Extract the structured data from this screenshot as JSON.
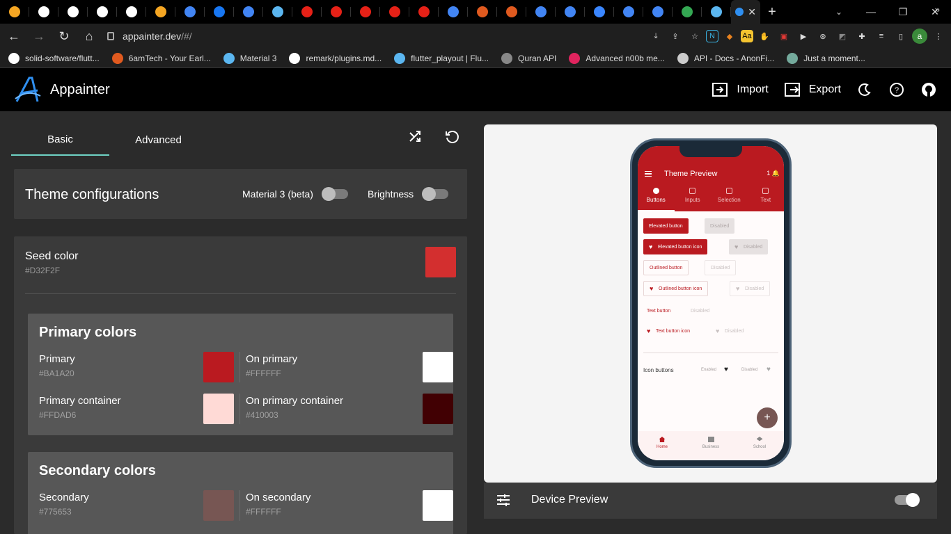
{
  "browser": {
    "tab_icons": [
      "fire-icon",
      "github-icon",
      "github-icon",
      "github-icon",
      "github-icon",
      "fire-icon",
      "google-icon",
      "facebook-icon",
      "google-icon",
      "flutter-icon",
      "youtube-icon",
      "youtube-icon",
      "youtube-icon",
      "youtube-icon",
      "youtube-icon",
      "google-icon",
      "6amtech-icon",
      "6amtech-icon",
      "google-icon",
      "google-icon",
      "clock-icon",
      "google-icon",
      "google-icon",
      "sheets-icon",
      "flutter-icon"
    ],
    "active_tab_icon": "appainter-icon",
    "url_domain": "appainter.dev",
    "url_path": "/#/",
    "bookmarks": [
      {
        "label": "solid-software/flutt...",
        "icon": "github-icon",
        "color": "#ffffff"
      },
      {
        "label": "6amTech - Your Earl...",
        "icon": "6amtech-icon",
        "color": "#e05a1f"
      },
      {
        "label": "Material 3",
        "icon": "flutter-icon",
        "color": "#5bb6f0"
      },
      {
        "label": "remark/plugins.md...",
        "icon": "github-icon",
        "color": "#ffffff"
      },
      {
        "label": "flutter_playout | Flu...",
        "icon": "flutter-icon",
        "color": "#5bb6f0"
      },
      {
        "label": "Quran API",
        "icon": "globe-icon",
        "color": "#888888"
      },
      {
        "label": "Advanced n00b me...",
        "icon": "heart-icon",
        "color": "#e0245e"
      },
      {
        "label": "API - Docs - AnonFi...",
        "icon": "anon-icon",
        "color": "#cccccc"
      },
      {
        "label": "Just a moment...",
        "icon": "chatgpt-icon",
        "color": "#74aa9c"
      }
    ],
    "profile_initial": "a"
  },
  "app": {
    "name": "Appainter",
    "import_label": "Import",
    "export_label": "Export"
  },
  "left": {
    "tabs": [
      "Basic",
      "Advanced"
    ],
    "theme_title": "Theme configurations",
    "material3_label": "Material 3 (beta)",
    "brightness_label": "Brightness",
    "seed_label": "Seed color",
    "seed_hex": "#D32F2F",
    "primary_group": {
      "title": "Primary colors",
      "items": [
        {
          "name": "Primary",
          "hex": "#BA1A20",
          "color": "#BA1A20"
        },
        {
          "name": "On primary",
          "hex": "#FFFFFF",
          "color": "#FFFFFF"
        },
        {
          "name": "Primary container",
          "hex": "#FFDAD6",
          "color": "#FFDAD6"
        },
        {
          "name": "On primary container",
          "hex": "#410003",
          "color": "#410003"
        }
      ]
    },
    "secondary_group": {
      "title": "Secondary colors",
      "items": [
        {
          "name": "Secondary",
          "hex": "#775653",
          "color": "#775653"
        },
        {
          "name": "On secondary",
          "hex": "#FFFFFF",
          "color": "#FFFFFF"
        }
      ]
    }
  },
  "preview": {
    "title": "Theme Preview",
    "badge": "1",
    "tabs": [
      "Buttons",
      "Inputs",
      "Selection",
      "Text"
    ],
    "buttons": {
      "elevated": "Elevated button",
      "disabled": "Disabled",
      "elevated_icon": "Elevated button icon",
      "outlined": "Outlined button",
      "outlined_icon": "Outlined button icon",
      "text": "Text button",
      "text_icon": "Text button icon"
    },
    "icon_buttons_label": "Icon buttons",
    "enabled_label": "Enabled",
    "fab_label": "+",
    "nav": [
      "Home",
      "Business",
      "School"
    ],
    "device_preview_label": "Device Preview"
  }
}
